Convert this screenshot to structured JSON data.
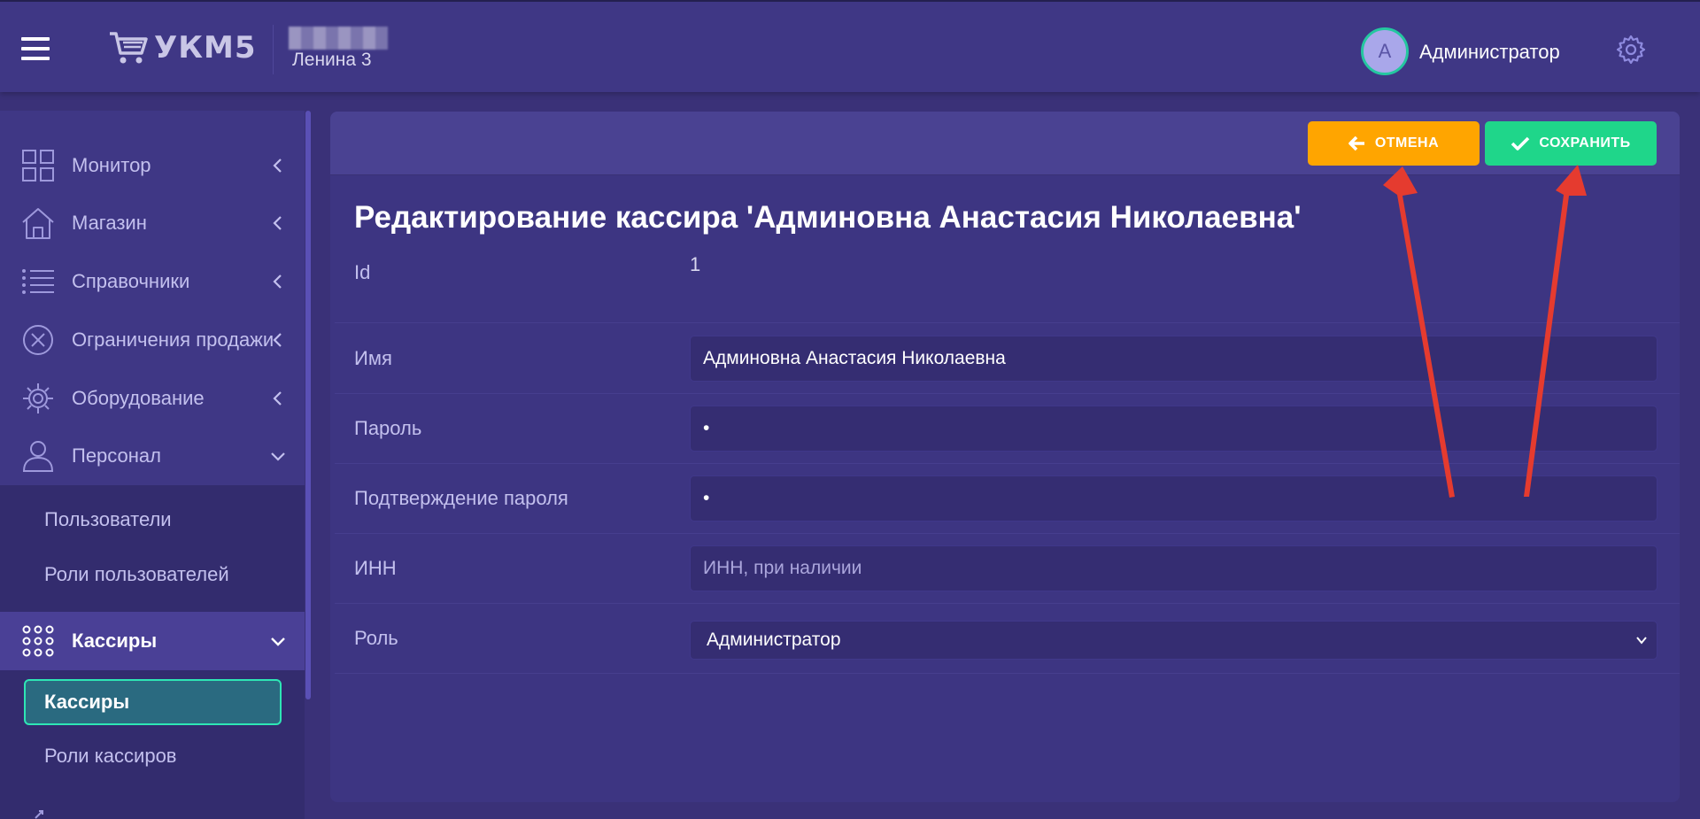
{
  "header": {
    "logo_text": "УКМ5",
    "store_name": "Ленина 3",
    "avatar_letter": "А",
    "user_name": "Администратор"
  },
  "sidebar": {
    "items": [
      {
        "label": "Монитор",
        "icon": "grid-icon"
      },
      {
        "label": "Магазин",
        "icon": "store-icon"
      },
      {
        "label": "Справочники",
        "icon": "list-icon"
      },
      {
        "label": "Ограничения продажи",
        "icon": "ban-icon"
      },
      {
        "label": "Оборудование",
        "icon": "gear-icon"
      },
      {
        "label": "Персонал",
        "icon": "user-icon"
      }
    ],
    "personnel_sub": [
      "Пользователи",
      "Роли пользователей"
    ],
    "cashiers_group": {
      "label": "Кассиры",
      "icon": "dots-grid-icon"
    },
    "cashiers_sub": [
      "Кассиры",
      "Роли кассиров"
    ]
  },
  "toolbar": {
    "cancel_label": "ОТМЕНА",
    "save_label": "СОХРАНИТЬ"
  },
  "form": {
    "title": "Редактирование кассира 'Админовна Анастасия Николаевна'",
    "id_label": "Id",
    "id_value": "1",
    "name_label": "Имя",
    "name_value": "Админовна Анастасия Николаевна",
    "password_label": "Пароль",
    "password_value": "•",
    "confirm_label": "Подтверждение пароля",
    "confirm_value": "•",
    "inn_label": "ИНН",
    "inn_placeholder": "ИНН, при наличии",
    "role_label": "Роль",
    "role_value": "Администратор"
  },
  "colors": {
    "background": "#3a3178",
    "cancel": "#ffa500",
    "save": "#1fd68a",
    "accent": "#2ee6b5",
    "annotation_arrow": "#e53b2f"
  }
}
